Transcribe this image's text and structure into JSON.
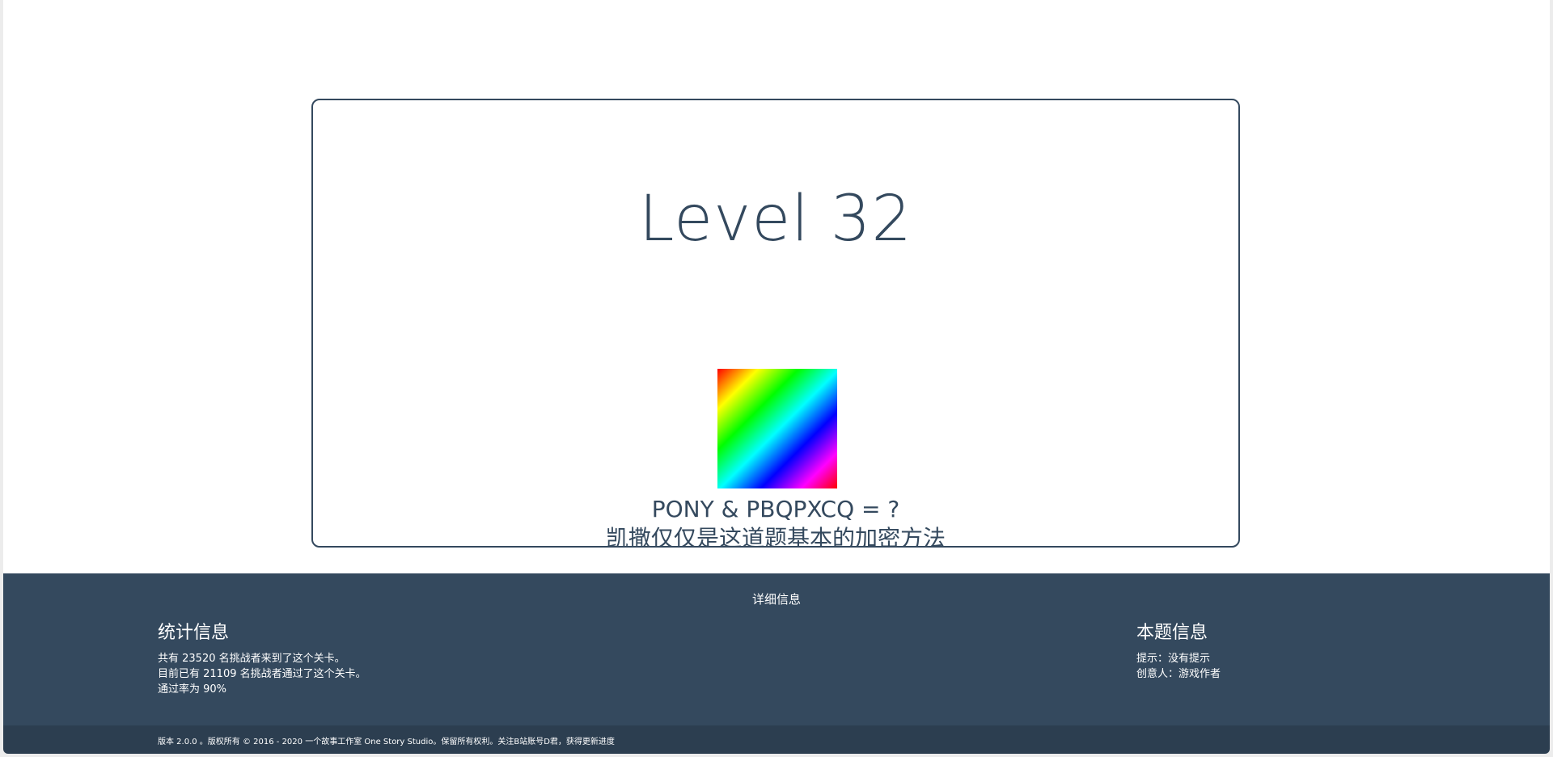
{
  "level": {
    "title": "Level 32",
    "equation": "PONY & PBQPXCQ = ?",
    "subtitle": "凯撒仅仅是这道题基本的加密方法",
    "image_icon": "rainbow-gradient-square"
  },
  "footer": {
    "heading": "详细信息",
    "stats": {
      "title": "统计信息",
      "lines": [
        "共有 23520 名挑战者来到了这个关卡。",
        "目前已有 21109 名挑战者通过了这个关卡。",
        "通过率为 90%"
      ]
    },
    "puzzle_info": {
      "title": "本题信息",
      "lines": [
        "提示：没有提示",
        "创意人：游戏作者"
      ]
    },
    "copyright": "版本 2.0.0 。版权所有 © 2016 - 2020 一个故事工作室 One Story Studio。保留所有权利。关注B站账号D君，获得更新进度"
  },
  "colors": {
    "primary": "#34495e",
    "footer_bottom": "#2c3e50",
    "background": "#ffffff"
  }
}
